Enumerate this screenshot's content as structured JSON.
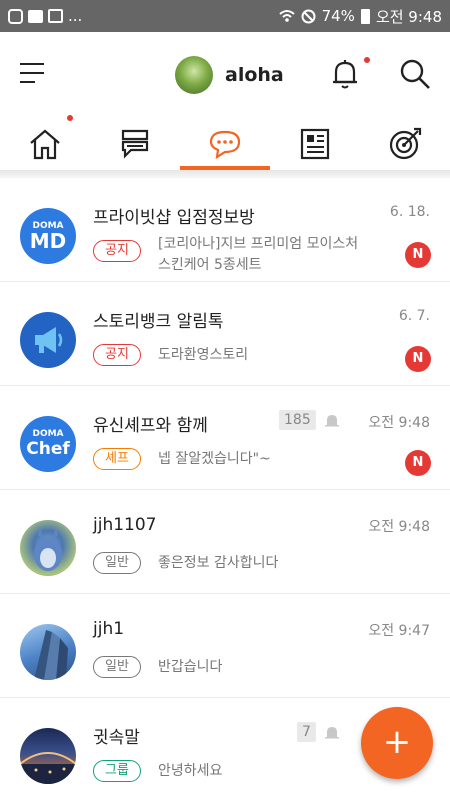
{
  "status_bar": {
    "notif_dots": "...",
    "battery": "74%",
    "clock": "오전 9:48"
  },
  "header": {
    "username": "aloha"
  },
  "tabs": [
    {
      "icon": "home-icon"
    },
    {
      "icon": "board-icon"
    },
    {
      "icon": "chat-icon"
    },
    {
      "icon": "news-icon"
    },
    {
      "icon": "target-icon"
    }
  ],
  "colors": {
    "accent": "#f26522",
    "badge": "#e53935",
    "doma_blue": "#2d7be0"
  },
  "chats": [
    {
      "title": "프라이빗샵 입점정보방",
      "time": "6. 18.",
      "tag": "공지",
      "preview_1": "[코리아나]지브 프리미엄 모이스처",
      "preview_2": "스킨케어 5종세트",
      "badge": "N",
      "avatar_line1": "DOMA",
      "avatar_line2": "MD"
    },
    {
      "title": "스토리뱅크 알림톡",
      "time": "6. 7.",
      "tag": "공지",
      "preview_1": "도라환영스토리",
      "badge": "N"
    },
    {
      "title": "유신셰프와 함께",
      "count": "185",
      "time": "오전 9:48",
      "tag": "셰프",
      "preview_1": "넵  잘알겠습니다\"~",
      "badge": "N",
      "avatar_line1": "DOMA",
      "avatar_line2": "Chef"
    },
    {
      "title": "jjh1107",
      "time": "오전 9:48",
      "tag": "일반",
      "preview_1": "좋은정보 감사합니다"
    },
    {
      "title": "jjh1",
      "time": "오전 9:47",
      "tag": "일반",
      "preview_1": "반갑습니다"
    },
    {
      "title": "귓속말",
      "count": "7",
      "tag": "그룹",
      "preview_1": "안녕하세요"
    }
  ],
  "fab": {
    "label": "+"
  }
}
